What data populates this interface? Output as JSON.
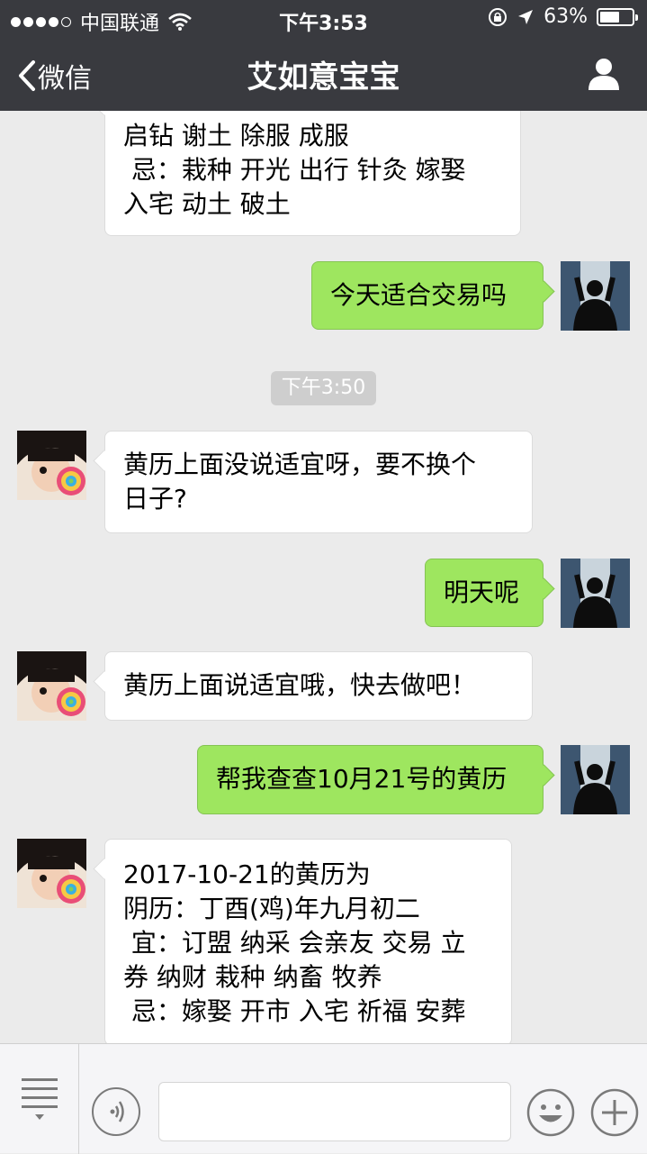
{
  "status_bar": {
    "carrier": "中国联通",
    "time": "下午3:53",
    "battery_text": "63%",
    "battery_level": 0.63
  },
  "nav": {
    "back_label": "微信",
    "title": "艾如意宝宝"
  },
  "chat": {
    "messages": [
      {
        "sender": "bot",
        "text": "启钻 谢土 除服 成服\n 忌：栽种 开光 出行 针灸 嫁娶\n入宅 动土 破土"
      },
      {
        "sender": "me",
        "text": "今天适合交易吗"
      },
      {
        "sender": "bot",
        "text": "黄历上面没说适宜呀，要不换个\n日子?"
      },
      {
        "sender": "me",
        "text": "明天呢"
      },
      {
        "sender": "bot",
        "text": "黄历上面说适宜哦，快去做吧！"
      },
      {
        "sender": "me",
        "text": "帮我查查10月21号的黄历"
      },
      {
        "sender": "bot",
        "text": "2017-10-21的黄历为\n阴历：丁酉(鸡)年九月初二\n 宜：订盟 纳采 会亲友 交易 立\n券 纳财 栽种 纳畜 牧养\n 忌：嫁娶 开市 入宅 祈福 安葬"
      }
    ],
    "timestamp": "下午3:50"
  },
  "colors": {
    "nav_bg": "#393a3f",
    "chat_bg": "#ebebeb",
    "outgoing_bubble": "#9ee65f",
    "incoming_bubble": "#ffffff",
    "timestamp_bg": "#cecece"
  },
  "icons": {
    "back": "chevron-left-icon",
    "profile": "person-icon",
    "menu": "list-menu-icon",
    "voice": "voice-icon",
    "emoji": "smile-icon",
    "more": "plus-icon",
    "wifi": "wifi-icon",
    "lock": "rotation-lock-icon",
    "location": "location-arrow-icon"
  }
}
